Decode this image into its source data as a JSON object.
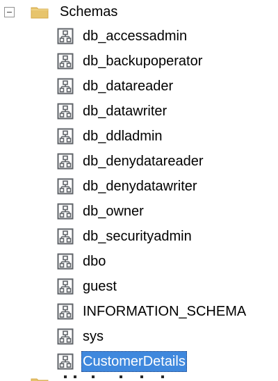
{
  "tree": {
    "folder": {
      "label": "Schemas",
      "icon": "folder-icon",
      "expanded": true,
      "expander_icon": "collapse-minus-icon"
    },
    "items": [
      {
        "label": "db_accessadmin",
        "icon": "schema-icon"
      },
      {
        "label": "db_backupoperator",
        "icon": "schema-icon"
      },
      {
        "label": "db_datareader",
        "icon": "schema-icon"
      },
      {
        "label": "db_datawriter",
        "icon": "schema-icon"
      },
      {
        "label": "db_ddladmin",
        "icon": "schema-icon"
      },
      {
        "label": "db_denydatareader",
        "icon": "schema-icon"
      },
      {
        "label": "db_denydatawriter",
        "icon": "schema-icon"
      },
      {
        "label": "db_owner",
        "icon": "schema-icon"
      },
      {
        "label": "db_securityadmin",
        "icon": "schema-icon"
      },
      {
        "label": "dbo",
        "icon": "schema-icon"
      },
      {
        "label": "guest",
        "icon": "schema-icon"
      },
      {
        "label": "INFORMATION_SCHEMA",
        "icon": "schema-icon"
      },
      {
        "label": "sys",
        "icon": "schema-icon"
      },
      {
        "label": "CustomerDetails",
        "icon": "schema-icon",
        "selected": true
      }
    ],
    "colors": {
      "selection_background": "#3f88dd",
      "selection_text": "#ffffff",
      "folder": "#e7c46c",
      "icon_stroke": "#5f6368"
    }
  }
}
